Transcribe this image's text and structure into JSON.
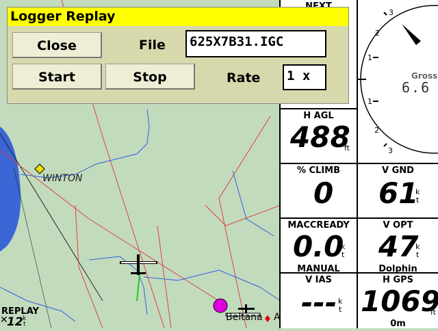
{
  "dialog": {
    "title": "Logger Replay",
    "close_label": "Close",
    "file_label": "File",
    "file_value": "625X7B31.IGC",
    "start_label": "Start",
    "stop_label": "Stop",
    "rate_label": "Rate",
    "rate_value": "1 x"
  },
  "map": {
    "waypoint_winton": "WINTON",
    "waypoint_beltana": "Beltana",
    "waypoint_fragment": "A",
    "mode_label": "REPLAY",
    "wind_value": "12",
    "wind_unit_top": "k",
    "wind_unit_bottom": "t"
  },
  "compass": {
    "top_caption": "NEXT",
    "gross_label": "Gross",
    "gross_value": "6.6",
    "ticks": [
      "3",
      "2",
      "1",
      "1",
      "2",
      "3"
    ]
  },
  "infoboxes": {
    "hagl": {
      "caption": "H AGL",
      "value": "488",
      "unit": "ft"
    },
    "climb": {
      "caption": "% CLIMB",
      "value": "0"
    },
    "vgnd": {
      "caption": "V GND",
      "value": "61",
      "unit_top": "k",
      "unit_bottom": "t"
    },
    "maccready": {
      "caption": "MACCREADY",
      "value": "0.0",
      "unit_top": "k",
      "unit_bottom": "t",
      "sub": "MANUAL"
    },
    "vopt": {
      "caption": "V OPT",
      "value": "47",
      "unit_top": "k",
      "unit_bottom": "t",
      "sub": "Dolphin"
    },
    "vias": {
      "caption": "V IAS",
      "value": "---",
      "unit_top": "k",
      "unit_bottom": "t"
    },
    "hgps": {
      "caption": "H GPS",
      "value": "1069",
      "unit": "ft",
      "sub": "0m"
    }
  },
  "colors": {
    "map_background": "#c2dbbd",
    "lake": "#3a66d6",
    "road": "#e04040",
    "river": "#3060e0",
    "railway": "#000000",
    "waypoint_winton": "#f0e000",
    "waypoint_target": "#e000e0",
    "title_bar": "#ffff00",
    "dialog_bg": "#d7d9ad"
  }
}
